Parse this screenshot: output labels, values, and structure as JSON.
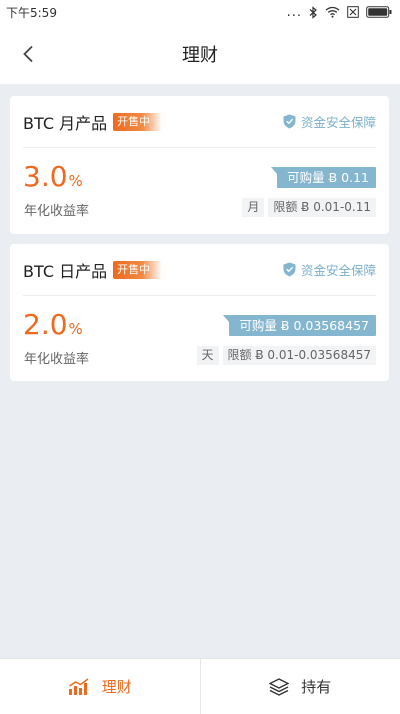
{
  "status_bar": {
    "time": "下午5:59",
    "dots": "..."
  },
  "nav": {
    "title": "理财"
  },
  "products": [
    {
      "name": "BTC 月产品",
      "badge": "开售中",
      "safety": "资金安全保障",
      "rate_value": "3.0",
      "rate_unit": "%",
      "rate_label": "年化收益率",
      "available": "可购量 Ƀ 0.11",
      "period": "月",
      "limit": "限额 Ƀ 0.01-0.11"
    },
    {
      "name": "BTC 日产品",
      "badge": "开售中",
      "safety": "资金安全保障",
      "rate_value": "2.0",
      "rate_unit": "%",
      "rate_label": "年化收益率",
      "available": "可购量 Ƀ 0.03568457",
      "period": "天",
      "limit": "限额 Ƀ 0.01-0.03568457"
    }
  ],
  "tabs": [
    {
      "label": "理财",
      "icon": "bar-chart-icon",
      "active": true
    },
    {
      "label": "持有",
      "icon": "layers-icon",
      "active": false
    }
  ],
  "colors": {
    "accent": "#ee6a1e",
    "tag_blue": "#85b6cf",
    "background": "#eaedf2"
  }
}
